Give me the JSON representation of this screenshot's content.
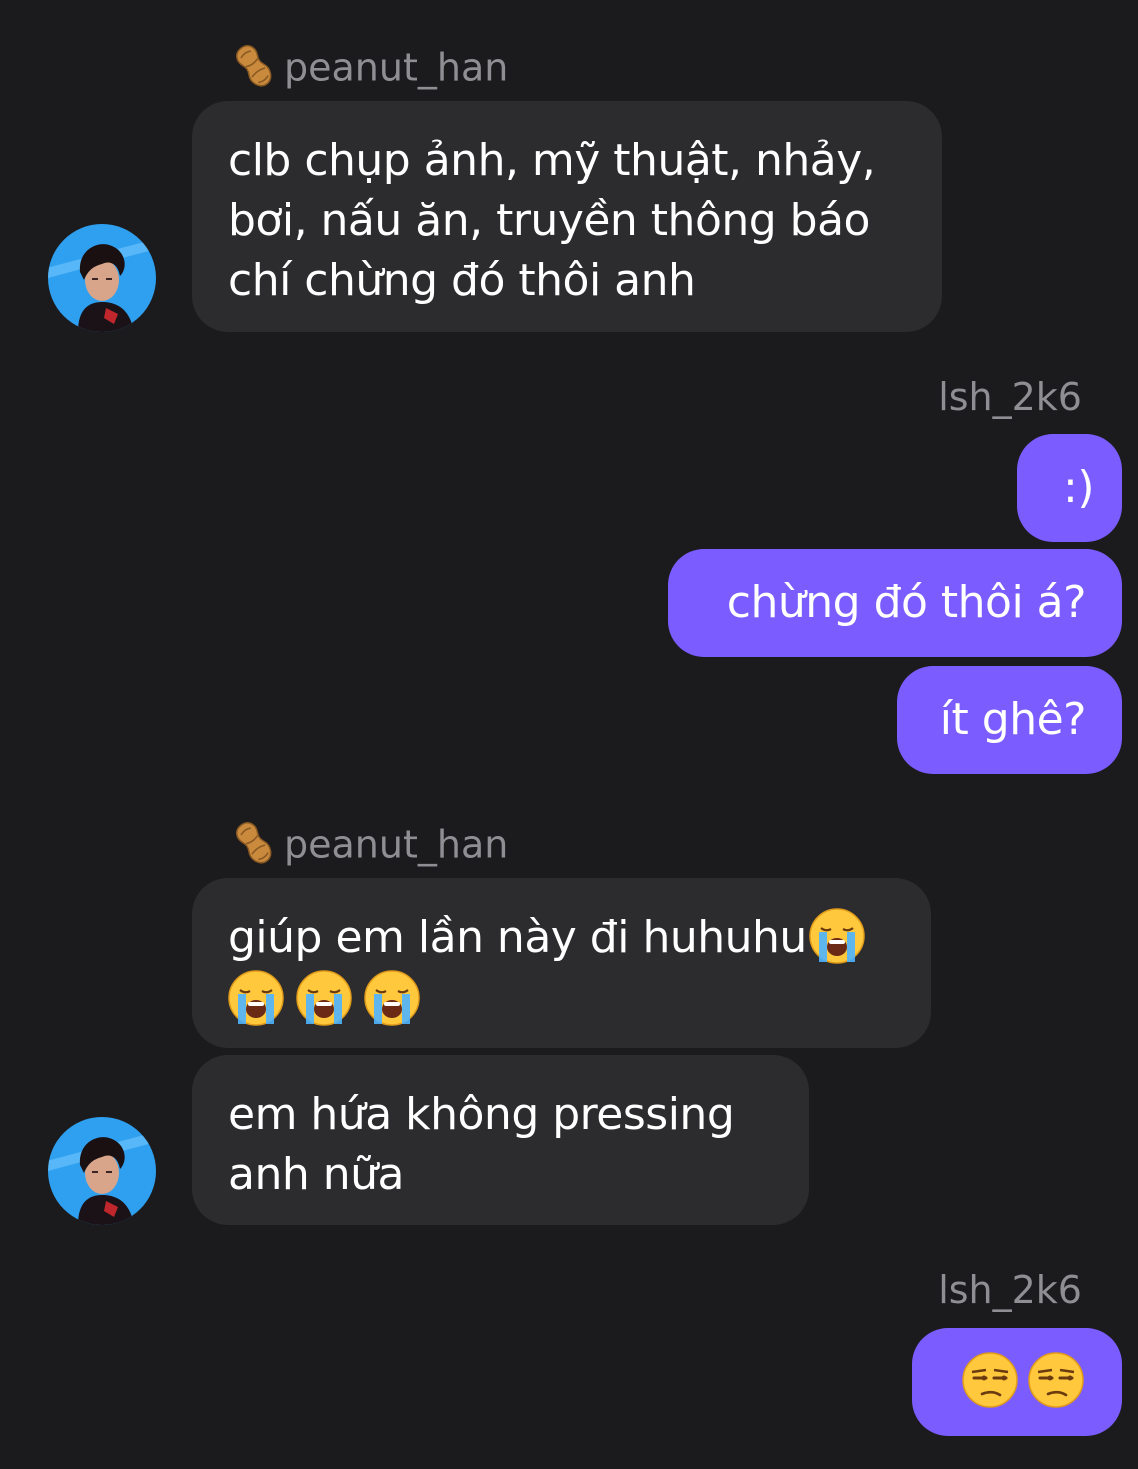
{
  "messages": [
    {
      "sender": "peanut_han",
      "text": "clb chụp ảnh, mỹ thuật, nhảy, bơi, nấu ăn, truyền thông báo chí chừng đó thôi anh"
    },
    {
      "sender": "lsh_2k6",
      "texts": [
        ":)",
        "chừng đó thôi á?",
        "ít ghê?"
      ]
    },
    {
      "sender": "peanut_han",
      "texts": [
        "giúp em lần này đi huhuhu",
        "em hứa không pressing anh nữa"
      ]
    },
    {
      "sender": "lsh_2k6",
      "emojis": [
        "unamused-face",
        "unamused-face"
      ]
    }
  ],
  "group1": {
    "sender": "peanut_han",
    "line1": "clb chụp ảnh, mỹ thuật, nhảy,",
    "line2": "bơi, nấu ăn, truyền thông báo",
    "line3": "chí chừng đó thôi anh"
  },
  "group2": {
    "sender": "lsh_2k6",
    "msg1": ":)",
    "msg2": "chừng đó thôi á?",
    "msg3": "ít ghê?"
  },
  "group3": {
    "sender": "peanut_han",
    "msg1_text": "giúp em lần này đi huhuhu",
    "msg1_emojis": [
      "loudly-crying-face",
      "loudly-crying-face",
      "loudly-crying-face",
      "loudly-crying-face"
    ],
    "msg2_line1": "em hứa không pressing",
    "msg2_line2": "anh nữa"
  },
  "group4": {
    "sender": "lsh_2k6",
    "emojis": [
      "unamused-face",
      "unamused-face"
    ]
  },
  "colors": {
    "background": "#1b1b1d",
    "incoming_bubble": "#2c2c2e",
    "outgoing_bubble": "#7b5cff",
    "sender_name": "#8e8e93"
  }
}
